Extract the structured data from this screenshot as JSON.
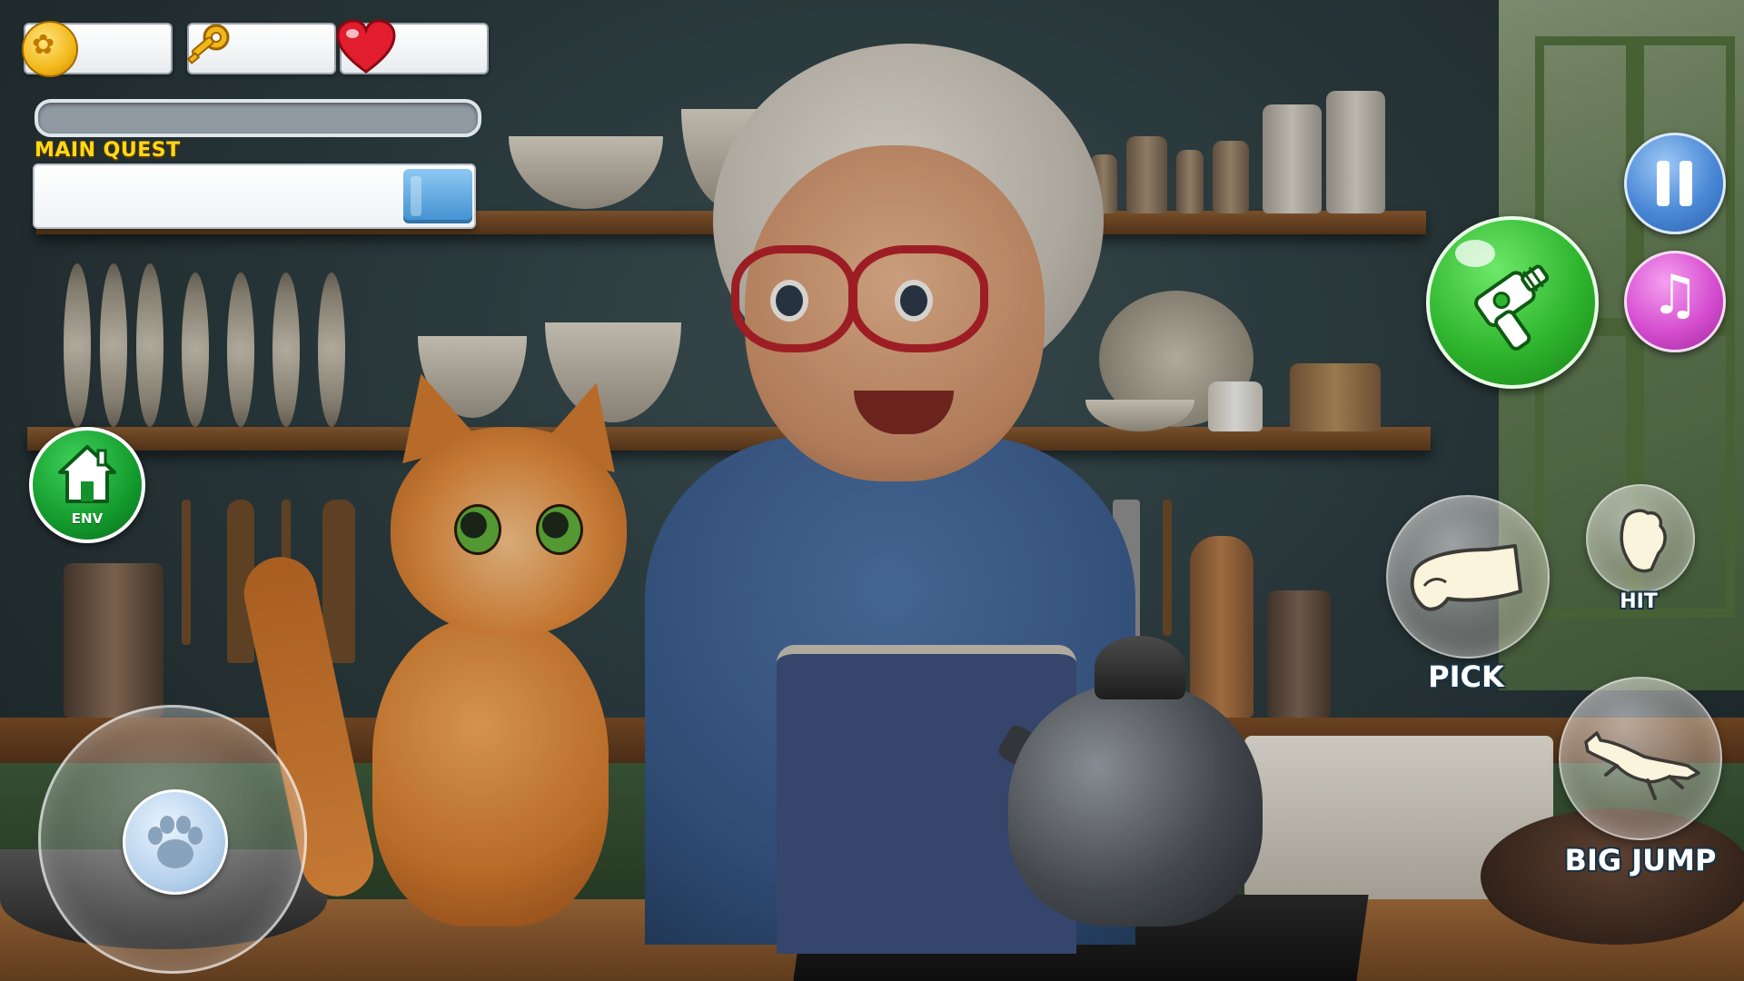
{
  "hud": {
    "coins": {
      "icon": "paw-coin-icon",
      "value": ""
    },
    "keys": {
      "icon": "key-icon",
      "value": ""
    },
    "lives": {
      "icon": "heart-icon",
      "value": ""
    },
    "xp_progress": 0
  },
  "quest": {
    "label": "MAIN QUEST",
    "text": ""
  },
  "buttons": {
    "env_label": "ENV",
    "pause_icon": "pause-icon",
    "music_icon": "music-note-icon",
    "music_glyph": "♫",
    "blaster_icon": "blaster-icon",
    "pick_label": "PICK",
    "hit_label": "HIT",
    "jump_label": "BIG JUMP",
    "joystick_icon": "paw-icon",
    "paw_glyph": "🐾"
  },
  "colors": {
    "quest_label": "#ffd81a",
    "env_green": "#139a2c",
    "blaster_green": "#2fb52e",
    "pause_blue": "#4a88d6",
    "music_pink": "#d64ed0",
    "heart_red": "#e11d2e",
    "coin_gold": "#f2b81a"
  }
}
